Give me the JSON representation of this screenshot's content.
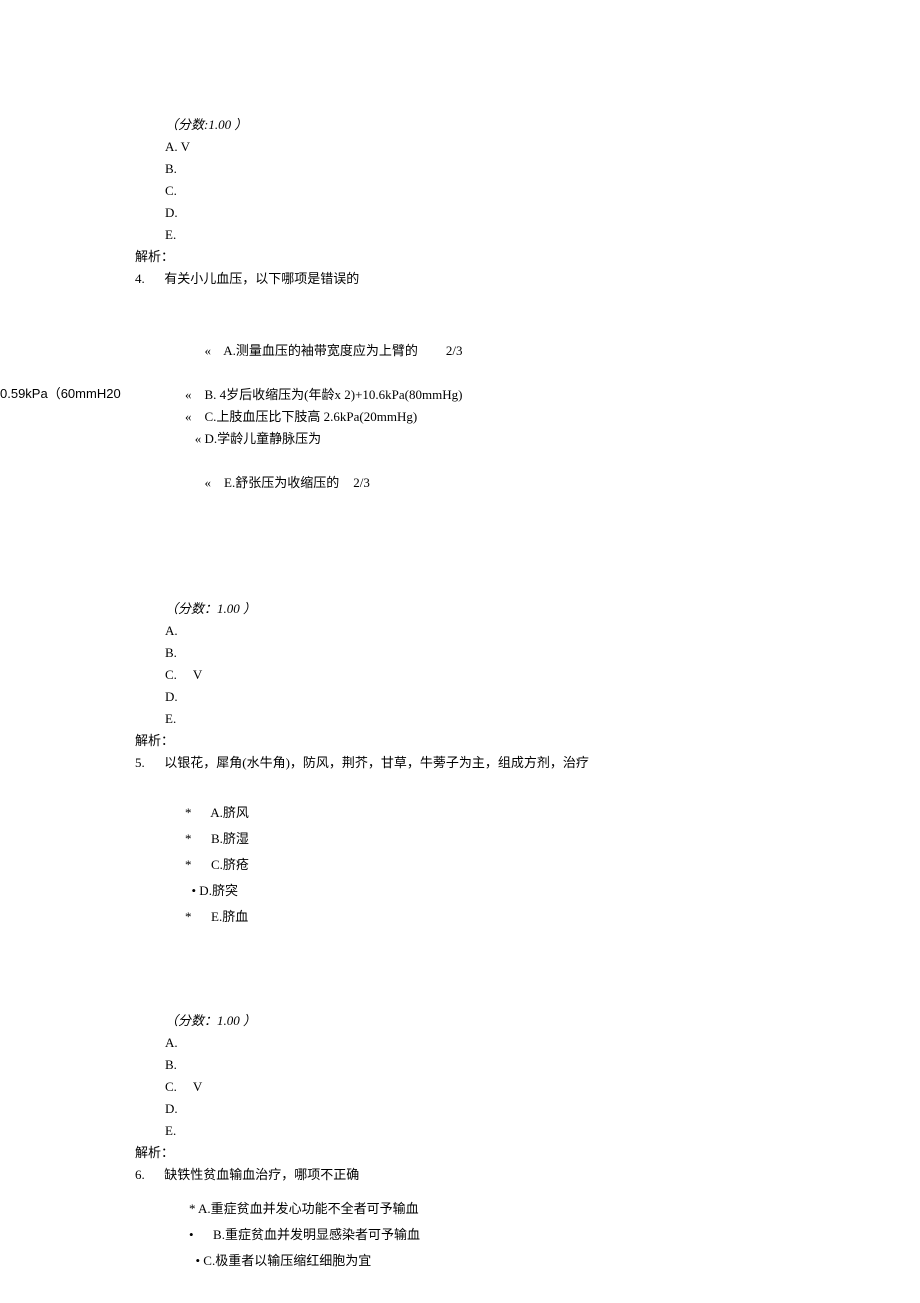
{
  "marginal_text": "0.59kPa（60mmH20",
  "q3": {
    "score_label": "（分数:1.00 ）",
    "optA": "A. V",
    "optB": "B.",
    "optC": "C.",
    "optD": "D.",
    "optE": "E.",
    "analysis_label": "解析："
  },
  "q4": {
    "number_line": "4.      有关小儿血压，以下哪项是错误的",
    "choiceA_prefix": "«    A.测量血压的袖带宽度应为上臂的",
    "choiceA_frac": "2/3",
    "choiceB": "«    B. 4岁后收缩压为(年龄x 2)+10.6kPa(80mmHg)",
    "choiceC": "«    C.上肢血压比下肢高 2.6kPa(20mmHg)",
    "choiceD": "   « D.学龄儿童静脉压为",
    "choiceE_prefix": "«    E.舒张压为收缩压的",
    "choiceE_frac": "2/3",
    "score_label": "（分数：1.00 ）",
    "optA": "A.",
    "optB": "B.",
    "optC": "C.     V",
    "optD": "D.",
    "optE": "E.",
    "analysis_label": "解析："
  },
  "q5": {
    "number_line": "5.      以银花，犀角(水牛角)，防风，荆芥，甘草，牛蒡子为主，组成方剂，治疗",
    "choiceA": "*      A.脐风",
    "choiceB": "*      B.脐湿",
    "choiceC": "*      C.脐疮",
    "choiceD": "  • D.脐突",
    "choiceE": "*      E.脐血",
    "score_label": "（分数：1.00 ）",
    "optA": "A.",
    "optB": "B.",
    "optC": "C.     V",
    "optD": "D.",
    "optE": "E.",
    "analysis_label": "解析："
  },
  "q6": {
    "number_line": "6.      缺铁性贫血输血治疗，哪项不正确",
    "choiceA": "* A.重症贫血并发心功能不全者可予输血",
    "choiceB": "•      B.重症贫血并发明显感染者可予输血",
    "choiceC": "  • C.极重者以输压缩红细胞为宜"
  }
}
